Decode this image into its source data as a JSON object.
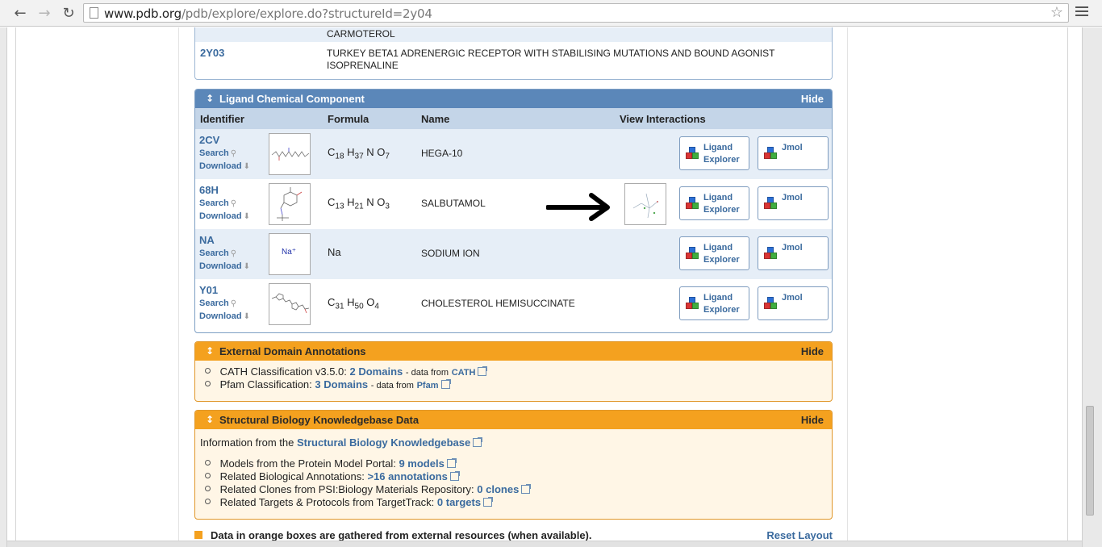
{
  "browser": {
    "url_host": "www.pdb.org",
    "url_path": "/pdb/explore/explore.do?structureId=2y04"
  },
  "entries": {
    "row1_text": "CARMOTEROL",
    "row2_id": "2Y03",
    "row2_text_line1": "TURKEY BETA1 ADRENERGIC RECEPTOR WITH STABILISING MUTATIONS AND BOUND AGONIST",
    "row2_text_line2": "ISOPRENALINE"
  },
  "ligand_panel": {
    "title": "Ligand Chemical Component",
    "hide": "Hide",
    "columns": {
      "identifier": "Identifier",
      "formula": "Formula",
      "name": "Name",
      "interactions": "View Interactions"
    },
    "search_label": "Search",
    "download_label": "Download",
    "ligand_explorer_line1": "Ligand",
    "ligand_explorer_line2": "Explorer",
    "jmol_label": "Jmol",
    "rows": [
      {
        "id": "2CV",
        "name": "HEGA-10"
      },
      {
        "id": "68H",
        "name": "SALBUTAMOL"
      },
      {
        "id": "NA",
        "name": "SODIUM ION",
        "formula": "Na",
        "thumb_text": "Na⁺"
      },
      {
        "id": "Y01",
        "name": "CHOLESTEROL HEMISUCCINATE"
      }
    ],
    "formulas": {
      "r0": {
        "a": "C",
        "a_n": "18",
        "b": " H",
        "b_n": "37",
        "c": " N O",
        "c_n": "7"
      },
      "r1": {
        "a": "C",
        "a_n": "13",
        "b": " H",
        "b_n": "21",
        "c": " N O",
        "c_n": "3"
      },
      "r3": {
        "a": "C",
        "a_n": "31",
        "b": " H",
        "b_n": "50",
        "c": " O",
        "c_n": "4"
      }
    }
  },
  "external_domain": {
    "title": "External Domain Annotations",
    "hide": "Hide",
    "cath_prefix": "CATH Classification v3.5.0:",
    "cath_link": "2 Domains",
    "cath_data_from": "- data from",
    "cath_source": "CATH",
    "pfam_prefix": "Pfam Classification:",
    "pfam_link": "3 Domains",
    "pfam_data_from": "- data from",
    "pfam_source": "Pfam"
  },
  "sbkb": {
    "title": "Structural Biology Knowledgebase Data",
    "hide": "Hide",
    "info_prefix": "Information from the",
    "info_link": "Structural Biology Knowledgebase",
    "items": [
      {
        "text": "Models from the Protein Model Portal:",
        "link": "9 models"
      },
      {
        "text": "Related Biological Annotations:",
        "link": ">16 annotations"
      },
      {
        "text": "Related Clones from PSI:Biology Materials Repository:",
        "link": "0 clones"
      },
      {
        "text": "Related Targets & Protocols from TargetTrack:",
        "link": "0 targets"
      }
    ]
  },
  "footer": {
    "legend_text": "Data in orange boxes are gathered from external resources (when available).",
    "reset_layout": "Reset Layout"
  },
  "colors": {
    "blue_header": "#5b87b9",
    "orange_header": "#f4a11f",
    "link": "#3a6a9e"
  }
}
